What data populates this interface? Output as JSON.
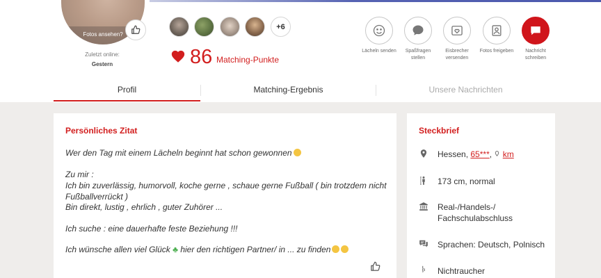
{
  "profile": {
    "photo_label": "Fotos ansehen?",
    "last_online_label": "Zuletzt online:",
    "last_online_value": "Gestern",
    "more_photos": "+6"
  },
  "matching": {
    "points": "86",
    "label": "Matching-Punkte"
  },
  "actions": [
    {
      "label": "Lächeln senden",
      "icon": "smile-icon"
    },
    {
      "label": "Spaßfragen\nstellen",
      "icon": "chat-bubble-icon"
    },
    {
      "label": "Eisbrecher\nversenden",
      "icon": "heart-envelope-icon"
    },
    {
      "label": "Fotos freigeben",
      "icon": "photo-person-icon"
    },
    {
      "label": "Nachricht\nschreiben",
      "icon": "message-icon"
    }
  ],
  "tabs": [
    {
      "label": "Profil",
      "active": true
    },
    {
      "label": "Matching-Ergebnis",
      "active": false
    },
    {
      "label": "Unsere Nachrichten",
      "active": false
    }
  ],
  "quote": {
    "title": "Persönliches Zitat",
    "lines": [
      "Wer den Tag mit einem Lächeln beginnt hat schon gewonnen",
      "Zu mir :",
      "Ich bin zuverlässig, humorvoll, koche gerne , schaue gerne Fußball ( bin trotzdem nicht",
      "Fußballverrückt )",
      "Bin direkt, lustig , ehrlich , guter Zuhörer ...",
      "Ich suche : eine dauerhafte feste Beziehung !!!",
      "Ich wünsche allen viel Glück",
      "hier den richtigen Partner/ in ... zu finden"
    ]
  },
  "steckbrief": {
    "title": "Steckbrief",
    "location": "Hessen,",
    "postal": "65***",
    "distance": "km",
    "height": "173 cm, normal",
    "education_line1": "Real-/Handels-/",
    "education_line2": "Fachschulabschluss",
    "languages": "Sprachen: Deutsch, Polnisch",
    "smoking": "Nichtraucher"
  },
  "colors": {
    "accent": "#d21e1e",
    "primary_button": "#d0151b",
    "background": "#efedeb"
  }
}
